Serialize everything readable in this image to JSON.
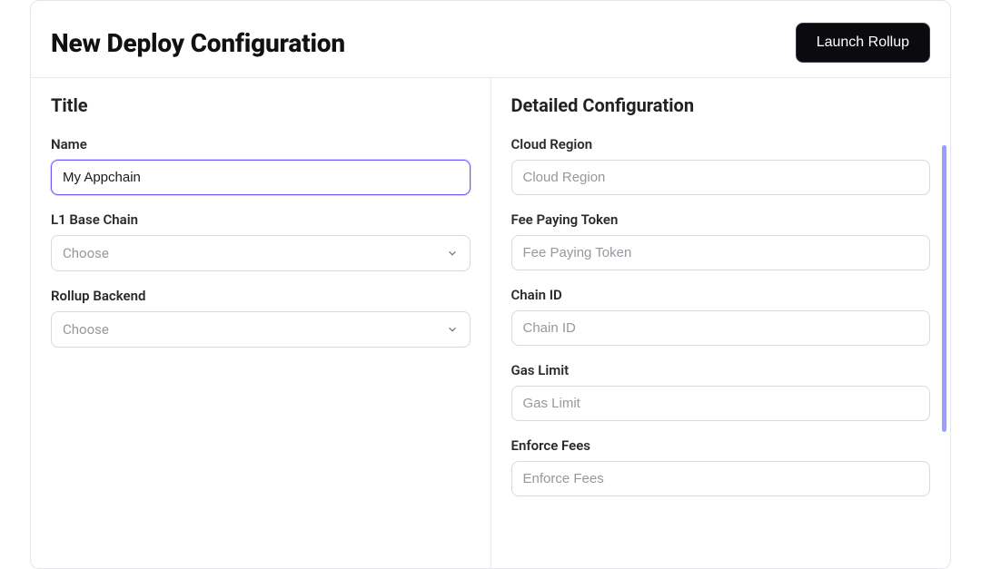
{
  "header": {
    "title": "New Deploy Configuration",
    "launch_label": "Launch Rollup"
  },
  "left": {
    "section_title": "Title",
    "name": {
      "label": "Name",
      "value": "My Appchain"
    },
    "l1": {
      "label": "L1 Base Chain",
      "placeholder": "Choose"
    },
    "backend": {
      "label": "Rollup Backend",
      "placeholder": "Choose"
    }
  },
  "right": {
    "section_title": "Detailed Configuration",
    "cloud_region": {
      "label": "Cloud Region",
      "placeholder": "Cloud Region"
    },
    "fee_token": {
      "label": "Fee Paying Token",
      "placeholder": "Fee Paying Token"
    },
    "chain_id": {
      "label": "Chain ID",
      "placeholder": "Chain ID"
    },
    "gas_limit": {
      "label": "Gas Limit",
      "placeholder": "Gas Limit"
    },
    "enforce_fees": {
      "label": "Enforce Fees",
      "placeholder": "Enforce Fees"
    }
  }
}
